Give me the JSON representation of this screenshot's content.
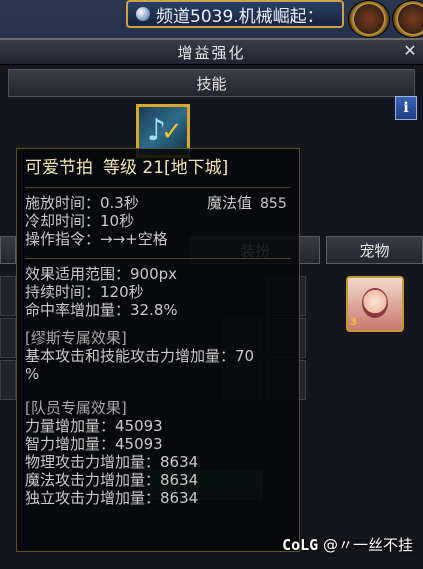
{
  "top_bar": {
    "channel_label": "频道5039.机械崛起："
  },
  "window": {
    "title": "增益强化",
    "section_label": "技能",
    "info_button_label": "i",
    "close_glyph": "✕"
  },
  "tabs": {
    "equip_label": "装扮",
    "pet_label": "宠物"
  },
  "pet": {
    "level": "3"
  },
  "tooltip": {
    "name": "可爱节拍",
    "level_label": "等级",
    "level_value": "21[地下城]",
    "cast_time": "施放时间：0.3秒",
    "mana_label": "魔法值",
    "mana_value": "855",
    "cooldown": "冷却时间：10秒",
    "command": "操作指令：→→+空格",
    "range": "效果适用范围：900px",
    "duration": "持续时间：120秒",
    "hit_rate": "命中率增加量：32.8%",
    "muse_header": "[缪斯专属效果]",
    "muse_line1": "基本攻击和技能攻击力增加量：70",
    "muse_line2": "%",
    "party_header": "[队员专属效果]",
    "str": "力量增加量：45093",
    "int": "智力增加量：45093",
    "phys_atk": "物理攻击力增加量：8634",
    "mag_atk": "魔法攻击力增加量：8634",
    "ind_atk": "独立攻击力增加量：8634"
  },
  "watermark": {
    "logo": "CoLG",
    "text": "@〃一丝不挂"
  },
  "colors": {
    "gold_border": "#d8a82a",
    "tooltip_title": "#f1e6b8",
    "info_blue": "#2f55a8"
  },
  "icons": [
    "globe-icon",
    "close-icon",
    "info-icon",
    "skill-beat-icon",
    "pet-portrait-icon"
  ]
}
